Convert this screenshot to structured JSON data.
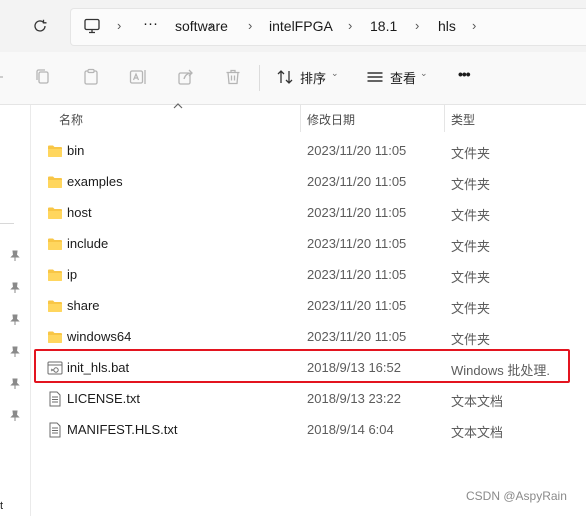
{
  "breadcrumbs": [
    "software",
    "intelFPGA",
    "18.1",
    "hls"
  ],
  "toolbar": {
    "sort_label": "排序",
    "view_label": "查看",
    "more_label": "•••"
  },
  "columns": {
    "name": "名称",
    "date": "修改日期",
    "type": "类型"
  },
  "files": [
    {
      "name": "bin",
      "date": "2023/11/20 11:05",
      "type": "文件夹",
      "kind": "folder"
    },
    {
      "name": "examples",
      "date": "2023/11/20 11:05",
      "type": "文件夹",
      "kind": "folder"
    },
    {
      "name": "host",
      "date": "2023/11/20 11:05",
      "type": "文件夹",
      "kind": "folder"
    },
    {
      "name": "include",
      "date": "2023/11/20 11:05",
      "type": "文件夹",
      "kind": "folder"
    },
    {
      "name": "ip",
      "date": "2023/11/20 11:05",
      "type": "文件夹",
      "kind": "folder"
    },
    {
      "name": "share",
      "date": "2023/11/20 11:05",
      "type": "文件夹",
      "kind": "folder"
    },
    {
      "name": "windows64",
      "date": "2023/11/20 11:05",
      "type": "文件夹",
      "kind": "folder"
    },
    {
      "name": "init_hls.bat",
      "date": "2018/9/13 16:52",
      "type": "Windows 批处理.",
      "kind": "bat"
    },
    {
      "name": "LICENSE.txt",
      "date": "2018/9/13 23:22",
      "type": "文本文档",
      "kind": "txt"
    },
    {
      "name": "MANIFEST.HLS.txt",
      "date": "2018/9/14 6:04",
      "type": "文本文档",
      "kind": "txt"
    }
  ],
  "sidebar": {
    "partial_text": "t"
  },
  "watermark": "CSDN @AspyRain",
  "colors": {
    "folder": "#f8c646",
    "highlight_border": "#e3141f"
  }
}
